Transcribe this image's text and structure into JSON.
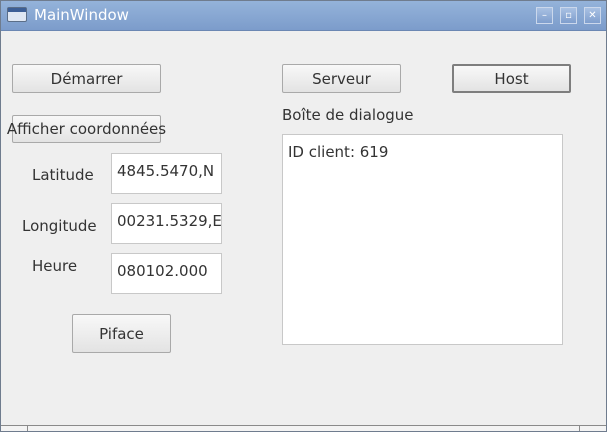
{
  "window": {
    "title": "MainWindow",
    "controls": {
      "minimize": "–",
      "maximize": "▫",
      "close": "✕"
    }
  },
  "buttons": {
    "start": "Démarrer",
    "show_coordinates": "Afficher coordonnées",
    "piface": "Piface",
    "server": "Serveur",
    "host": "Host"
  },
  "coordinates": {
    "latitude_label": "Latitude",
    "latitude_value": "4845.5470,N",
    "longitude_label": "Longitude",
    "longitude_value": "00231.5329,E",
    "time_label": "Heure",
    "time_value": "080102.000"
  },
  "dialog": {
    "label": "Boîte de dialogue",
    "content": "ID client: 619"
  },
  "icons": {
    "app": "window-app-icon",
    "minimize": "minimize-icon",
    "maximize": "maximize-icon",
    "close": "close-icon"
  }
}
